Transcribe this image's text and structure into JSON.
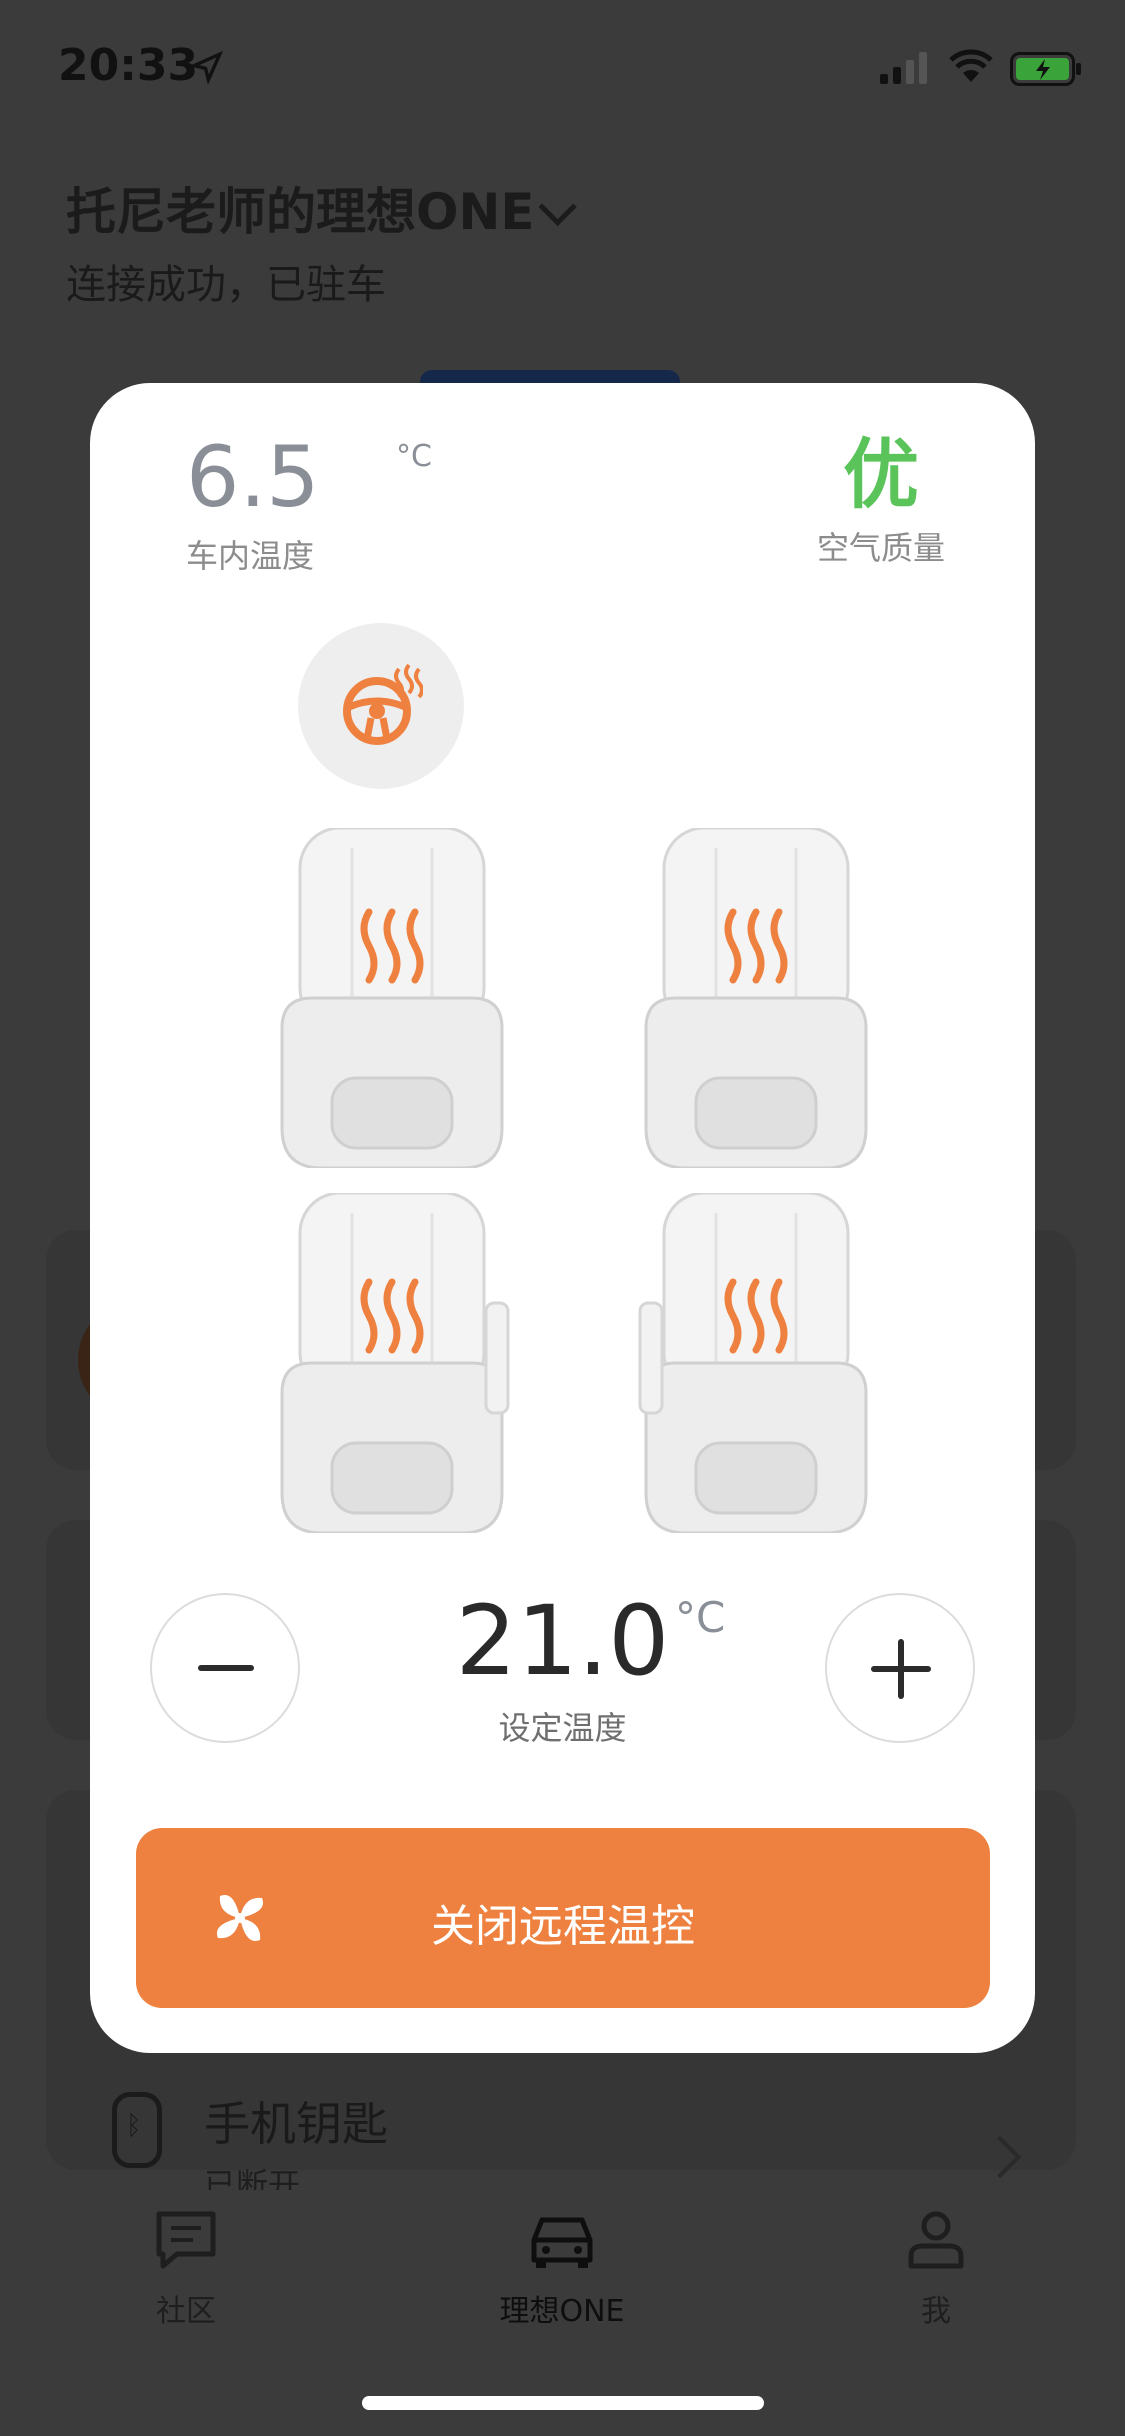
{
  "status_bar": {
    "time": "20:33"
  },
  "header": {
    "car_name": "托尼老师的理想ONE",
    "status": "连接成功，已驻车"
  },
  "phone_key": {
    "label": "手机钥匙",
    "status": "已断开"
  },
  "tabs": [
    {
      "label": "社区",
      "icon": "chat-icon"
    },
    {
      "label": "理想ONE",
      "icon": "car-icon"
    },
    {
      "label": "我",
      "icon": "person-icon"
    }
  ],
  "modal": {
    "cabin_temp": {
      "value": "6.5",
      "unit": "°C",
      "label": "车内温度"
    },
    "air_quality": {
      "value": "优",
      "label": "空气质量"
    },
    "set_temp": {
      "value": "21.0",
      "unit": "°C",
      "label": "设定温度"
    },
    "action_button": {
      "label": "关闭远程温控"
    },
    "seats": [
      "front-left",
      "front-right",
      "rear-left",
      "rear-right"
    ],
    "colors": {
      "accent": "#ee813f",
      "good": "#5ac45a"
    }
  }
}
